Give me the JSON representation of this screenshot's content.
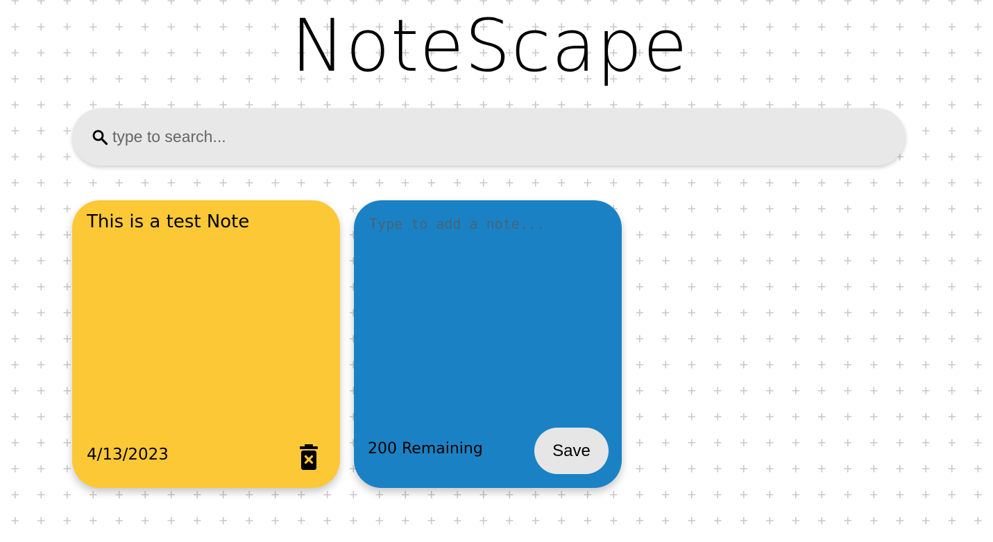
{
  "app": {
    "title": "NoteScape"
  },
  "search": {
    "placeholder": "type to search...",
    "value": "",
    "icon": "search-icon"
  },
  "notes": [
    {
      "text": "This is a test Note",
      "date": "4/13/2023",
      "color": "#fdc836",
      "delete_icon": "trash-x-icon"
    }
  ],
  "new_note": {
    "placeholder": "Type to add a note...",
    "value": "",
    "remaining_label": "200 Remaining",
    "save_label": "Save",
    "color": "#1a82c4"
  },
  "theme": {
    "background": "#ffffff",
    "pattern_color": "#c8c8c8",
    "search_bg": "#e8e8e8",
    "button_bg": "#e6e6e6"
  }
}
